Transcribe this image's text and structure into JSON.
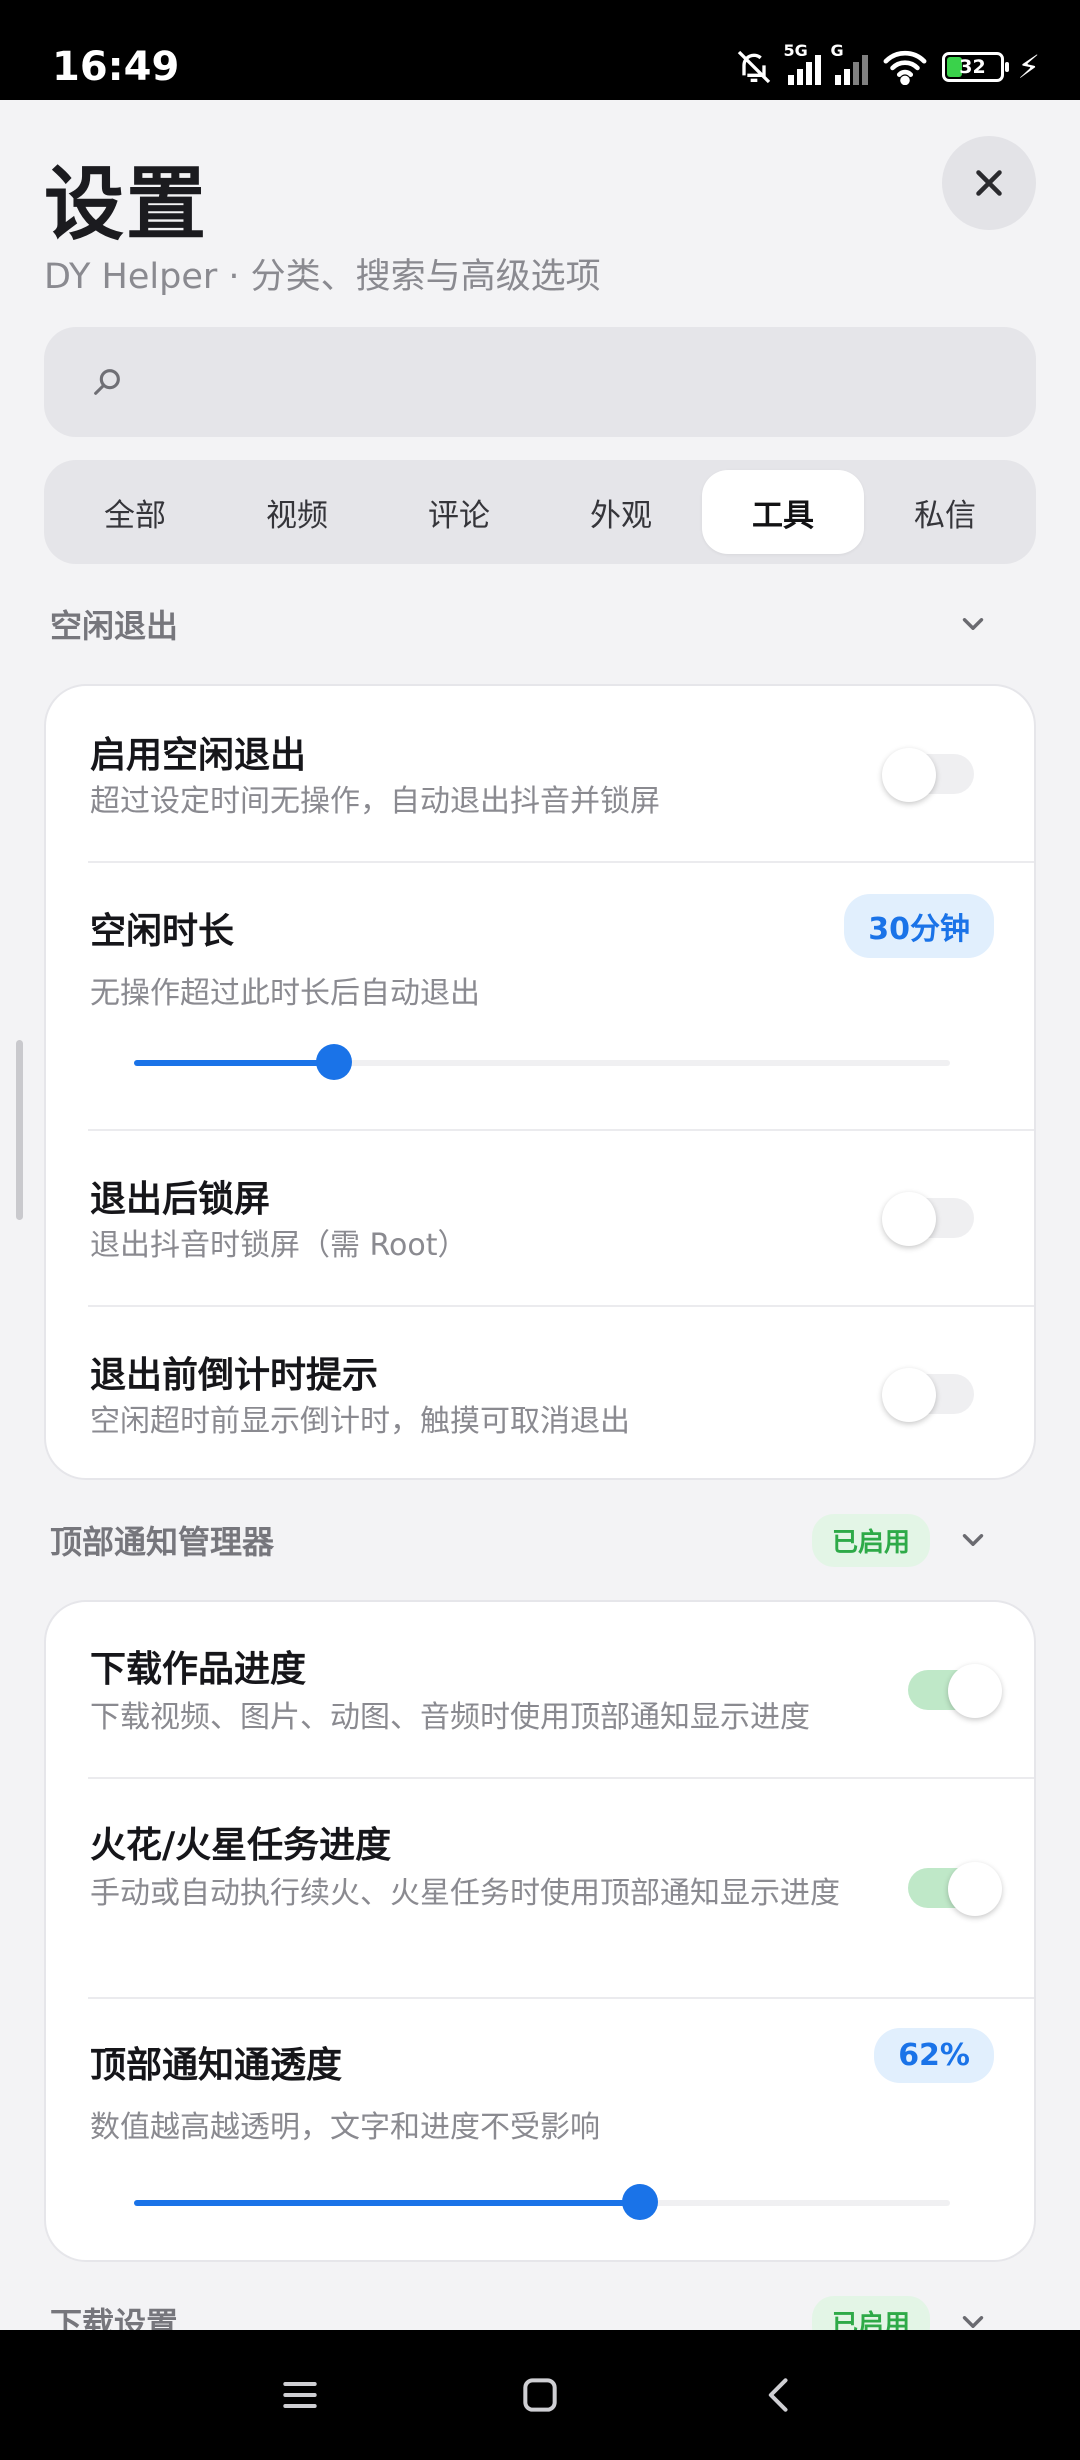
{
  "status_bar": {
    "time": "16:49",
    "network": "5G",
    "network2": "G",
    "battery": "32"
  },
  "header": {
    "title": "设置",
    "subtitle": "DY Helper · 分类、搜索与高级选项"
  },
  "search": {
    "placeholder": ""
  },
  "tabs": [
    {
      "label": "全部",
      "active": false
    },
    {
      "label": "视频",
      "active": false
    },
    {
      "label": "评论",
      "active": false
    },
    {
      "label": "外观",
      "active": false
    },
    {
      "label": "工具",
      "active": true
    },
    {
      "label": "私信",
      "active": false
    }
  ],
  "sections": [
    {
      "title": "空闲退出",
      "badge": "",
      "rows": [
        {
          "title": "启用空闲退出",
          "desc": "超过设定时间无操作，自动退出抖音并锁屏",
          "toggle": false
        },
        {
          "title": "空闲时长",
          "desc": "无操作超过此时长后自动退出",
          "value": "30分钟",
          "slider_fraction": 0.245
        },
        {
          "title": "退出后锁屏",
          "desc": "退出抖音时锁屏（需 Root）",
          "toggle": false
        },
        {
          "title": "退出前倒计时提示",
          "desc": "空闲超时前显示倒计时，触摸可取消退出",
          "toggle": false
        }
      ]
    },
    {
      "title": "顶部通知管理器",
      "badge": "已启用",
      "rows": [
        {
          "title": "下载作品进度",
          "desc": "下载视频、图片、动图、音频时使用顶部通知显示进度",
          "toggle": true
        },
        {
          "title": "火花/火星任务进度",
          "desc": "手动或自动执行续火、火星任务时使用顶部通知显示进度",
          "toggle": true
        },
        {
          "title": "顶部通知通透度",
          "desc": "数值越高越透明，文字和进度不受影响",
          "value": "62%",
          "slider_fraction": 0.62
        }
      ]
    },
    {
      "title": "下载设置",
      "badge": "已启用"
    }
  ],
  "colors": {
    "accent": "#1a73e8",
    "enabled_green": "#2eaa48",
    "background": "#f3f3f5"
  }
}
